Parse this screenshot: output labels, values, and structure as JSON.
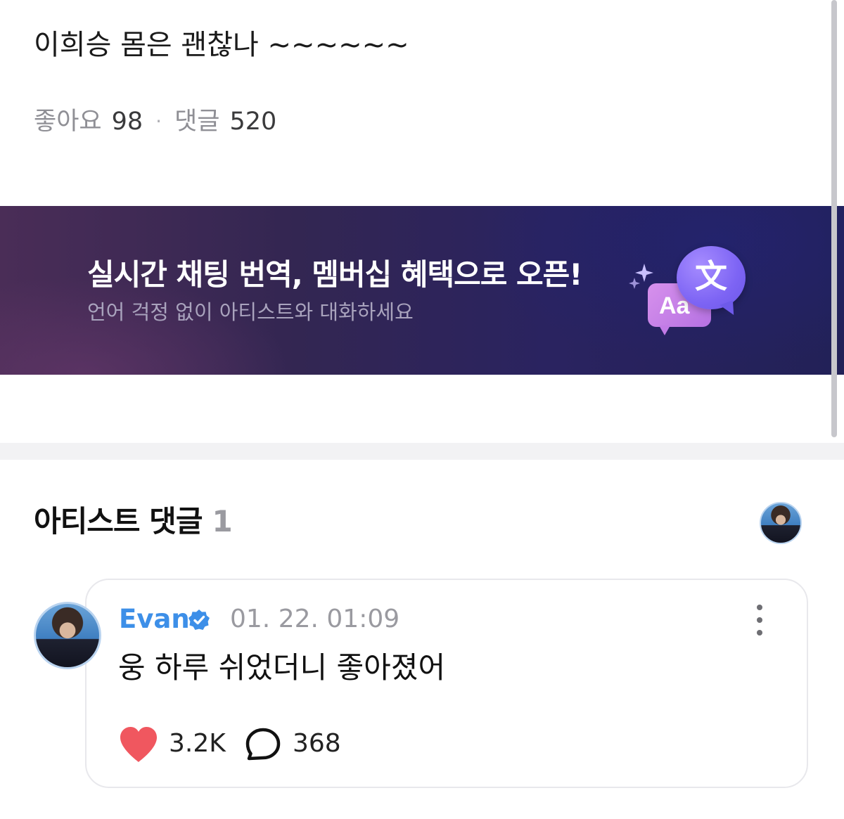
{
  "post": {
    "text": "이희승 몸은 괜찮나 ~~~~~~",
    "likes_label": "좋아요",
    "likes_count": "98",
    "separator": "·",
    "comments_label": "댓글",
    "comments_count": "520"
  },
  "banner": {
    "title": "실시간 채팅 번역, 멤버십 혜택으로 오픈!",
    "subtitle": "언어 걱정 없이 아티스트와 대화하세요",
    "aa_text": "Aa",
    "translate_glyph": "文",
    "colors": {
      "start": "#4a2d57",
      "end": "#222157"
    }
  },
  "artist_comments": {
    "title": "아티스트 댓글",
    "count": "1"
  },
  "comment": {
    "author": "Evan",
    "timestamp": "01. 22. 01:09",
    "text": "웅 하루 쉬었더니 좋아졌어",
    "likes": "3.2K",
    "replies": "368",
    "icons": [
      "verified-badge-icon",
      "more-vertical-icon",
      "heart-icon",
      "speech-bubble-icon"
    ],
    "colors": {
      "author": "#3d8fe8",
      "heart": "#f0575f"
    }
  }
}
